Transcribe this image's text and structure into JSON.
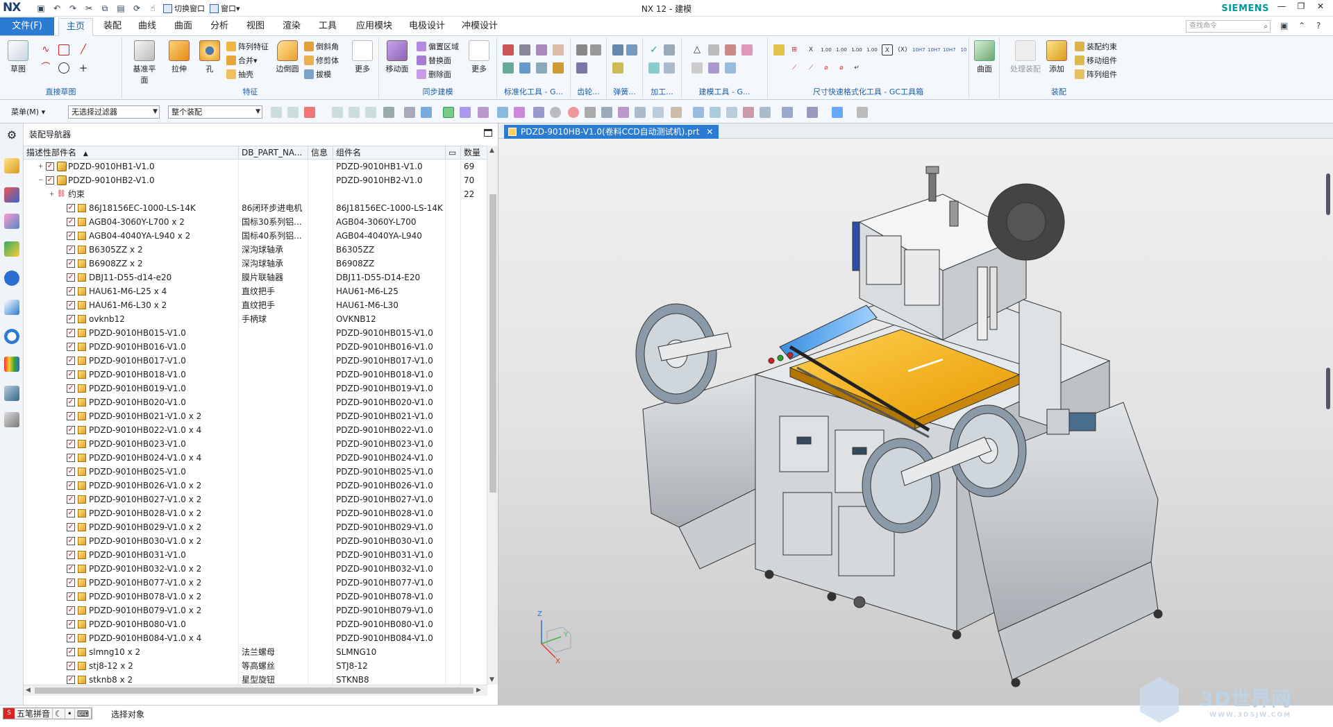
{
  "app": {
    "logo": "NX",
    "title": "NX 12 - 建模",
    "brand": "SIEMENS"
  },
  "quick_access": {
    "switch_window": "切换窗口",
    "window": "窗口"
  },
  "tabs": [
    {
      "label": "文件(F)"
    },
    {
      "label": "主页"
    },
    {
      "label": "装配"
    },
    {
      "label": "曲线"
    },
    {
      "label": "曲面"
    },
    {
      "label": "分析"
    },
    {
      "label": "视图"
    },
    {
      "label": "渲染"
    },
    {
      "label": "工具"
    },
    {
      "label": "应用模块"
    },
    {
      "label": "电极设计"
    },
    {
      "label": "冲模设计"
    }
  ],
  "search": {
    "placeholder": "查找命令"
  },
  "ribbon": {
    "groups": [
      {
        "label": "直接草图"
      },
      {
        "label": "特征"
      },
      {
        "label": "同步建模"
      },
      {
        "label": "标准化工具 - G..."
      },
      {
        "label": "齿轮..."
      },
      {
        "label": "弹簧..."
      },
      {
        "label": "加工..."
      },
      {
        "label": "建模工具 - G..."
      },
      {
        "label": "尺寸快速格式化工具 - GC工具箱"
      },
      {
        "label": "装配"
      }
    ],
    "buttons": {
      "sketch": "草图",
      "datum_plane": "基准平面",
      "extrude": "拉伸",
      "hole": "孔",
      "pattern_feature": "阵列特征",
      "unite": "合并",
      "shell": "抽壳",
      "edge_blend": "边倒圆",
      "chamfer": "倒斜角",
      "trim_body": "修剪体",
      "draft": "拔模",
      "more1": "更多",
      "move_face": "移动面",
      "offset_region": "偏置区域",
      "replace_face": "替换面",
      "delete_face": "删除面",
      "more2": "更多",
      "surface": "曲面",
      "process_assembly": "处理装配",
      "add": "添加",
      "assembly_constraints": "装配约束",
      "move_component": "移动组件",
      "pattern_component": "阵列组件"
    }
  },
  "cmdbar": {
    "menu": "菜单(M)",
    "filter": "无选择过滤器",
    "scope": "整个装配"
  },
  "navigator": {
    "title": "装配导航器",
    "columns": [
      "描述性部件名",
      "DB_PART_NA...",
      "信息",
      "组件名",
      "",
      "数量"
    ],
    "rows": [
      {
        "name": "PDZD-9010HB1-V1.0",
        "db": "",
        "comp": "PDZD-9010HB1-V1.0",
        "qty": "69"
      },
      {
        "name": "PDZD-9010HB2-V1.0",
        "db": "",
        "comp": "PDZD-9010HB2-V1.0",
        "qty": "70"
      },
      {
        "name": "约束",
        "db": "",
        "comp": "",
        "qty": "22"
      },
      {
        "name": "86J18156EC-1000-LS-14K",
        "db": "86闭环步进电机",
        "comp": "86J18156EC-1000-LS-14K",
        "qty": ""
      },
      {
        "name": "AGB04-3060Y-L700 x 2",
        "db": "国标30系列铝...",
        "comp": "AGB04-3060Y-L700",
        "qty": ""
      },
      {
        "name": "AGB04-4040YA-L940 x 2",
        "db": "国标40系列铝...",
        "comp": "AGB04-4040YA-L940",
        "qty": ""
      },
      {
        "name": "B6305ZZ x 2",
        "db": "深沟球轴承",
        "comp": "B6305ZZ",
        "qty": ""
      },
      {
        "name": "B6908ZZ x 2",
        "db": "深沟球轴承",
        "comp": "B6908ZZ",
        "qty": ""
      },
      {
        "name": "DBJ11-D55-d14-e20",
        "db": "膜片联轴器",
        "comp": "DBJ11-D55-D14-E20",
        "qty": ""
      },
      {
        "name": "HAU61-M6-L25 x 4",
        "db": "直纹把手",
        "comp": "HAU61-M6-L25",
        "qty": ""
      },
      {
        "name": "HAU61-M6-L30 x 2",
        "db": "直纹把手",
        "comp": "HAU61-M6-L30",
        "qty": ""
      },
      {
        "name": "ovknb12",
        "db": "手柄球",
        "comp": "OVKNB12",
        "qty": ""
      },
      {
        "name": "PDZD-9010HB015-V1.0",
        "db": "",
        "comp": "PDZD-9010HB015-V1.0",
        "qty": ""
      },
      {
        "name": "PDZD-9010HB016-V1.0",
        "db": "",
        "comp": "PDZD-9010HB016-V1.0",
        "qty": ""
      },
      {
        "name": "PDZD-9010HB017-V1.0",
        "db": "",
        "comp": "PDZD-9010HB017-V1.0",
        "qty": ""
      },
      {
        "name": "PDZD-9010HB018-V1.0",
        "db": "",
        "comp": "PDZD-9010HB018-V1.0",
        "qty": ""
      },
      {
        "name": "PDZD-9010HB019-V1.0",
        "db": "",
        "comp": "PDZD-9010HB019-V1.0",
        "qty": ""
      },
      {
        "name": "PDZD-9010HB020-V1.0",
        "db": "",
        "comp": "PDZD-9010HB020-V1.0",
        "qty": ""
      },
      {
        "name": "PDZD-9010HB021-V1.0 x 2",
        "db": "",
        "comp": "PDZD-9010HB021-V1.0",
        "qty": ""
      },
      {
        "name": "PDZD-9010HB022-V1.0 x 4",
        "db": "",
        "comp": "PDZD-9010HB022-V1.0",
        "qty": ""
      },
      {
        "name": "PDZD-9010HB023-V1.0",
        "db": "",
        "comp": "PDZD-9010HB023-V1.0",
        "qty": ""
      },
      {
        "name": "PDZD-9010HB024-V1.0 x 4",
        "db": "",
        "comp": "PDZD-9010HB024-V1.0",
        "qty": ""
      },
      {
        "name": "PDZD-9010HB025-V1.0",
        "db": "",
        "comp": "PDZD-9010HB025-V1.0",
        "qty": ""
      },
      {
        "name": "PDZD-9010HB026-V1.0 x 2",
        "db": "",
        "comp": "PDZD-9010HB026-V1.0",
        "qty": ""
      },
      {
        "name": "PDZD-9010HB027-V1.0 x 2",
        "db": "",
        "comp": "PDZD-9010HB027-V1.0",
        "qty": ""
      },
      {
        "name": "PDZD-9010HB028-V1.0 x 2",
        "db": "",
        "comp": "PDZD-9010HB028-V1.0",
        "qty": ""
      },
      {
        "name": "PDZD-9010HB029-V1.0 x 2",
        "db": "",
        "comp": "PDZD-9010HB029-V1.0",
        "qty": ""
      },
      {
        "name": "PDZD-9010HB030-V1.0 x 2",
        "db": "",
        "comp": "PDZD-9010HB030-V1.0",
        "qty": ""
      },
      {
        "name": "PDZD-9010HB031-V1.0",
        "db": "",
        "comp": "PDZD-9010HB031-V1.0",
        "qty": ""
      },
      {
        "name": "PDZD-9010HB032-V1.0 x 2",
        "db": "",
        "comp": "PDZD-9010HB032-V1.0",
        "qty": ""
      },
      {
        "name": "PDZD-9010HB077-V1.0 x 2",
        "db": "",
        "comp": "PDZD-9010HB077-V1.0",
        "qty": ""
      },
      {
        "name": "PDZD-9010HB078-V1.0 x 2",
        "db": "",
        "comp": "PDZD-9010HB078-V1.0",
        "qty": ""
      },
      {
        "name": "PDZD-9010HB079-V1.0 x 2",
        "db": "",
        "comp": "PDZD-9010HB079-V1.0",
        "qty": ""
      },
      {
        "name": "PDZD-9010HB080-V1.0",
        "db": "",
        "comp": "PDZD-9010HB080-V1.0",
        "qty": ""
      },
      {
        "name": "PDZD-9010HB084-V1.0 x 4",
        "db": "",
        "comp": "PDZD-9010HB084-V1.0",
        "qty": ""
      },
      {
        "name": "slmng10 x 2",
        "db": "法兰螺母",
        "comp": "SLMNG10",
        "qty": ""
      },
      {
        "name": "stj8-12 x 2",
        "db": "等高螺丝",
        "comp": "STJ8-12",
        "qty": ""
      },
      {
        "name": "stknb8 x 2",
        "db": "星型旋钮",
        "comp": "STKNB8",
        "qty": ""
      }
    ]
  },
  "graphics": {
    "tab": "PDZD-9010HB-V1.0(卷料CCD自动测试机).prt",
    "triad": {
      "z": "Z",
      "y": "Y",
      "x": "X"
    }
  },
  "statusbar": {
    "ime": "五笔拼音",
    "text": "选择对象",
    "watermark": "3D世界网",
    "watermark_sub": "WWW.3DSJW.COM"
  },
  "colors": {
    "accent": "#2a7bd1",
    "ribbon_bg": "#f4f8fc",
    "table_yellow": "#f5b400"
  }
}
